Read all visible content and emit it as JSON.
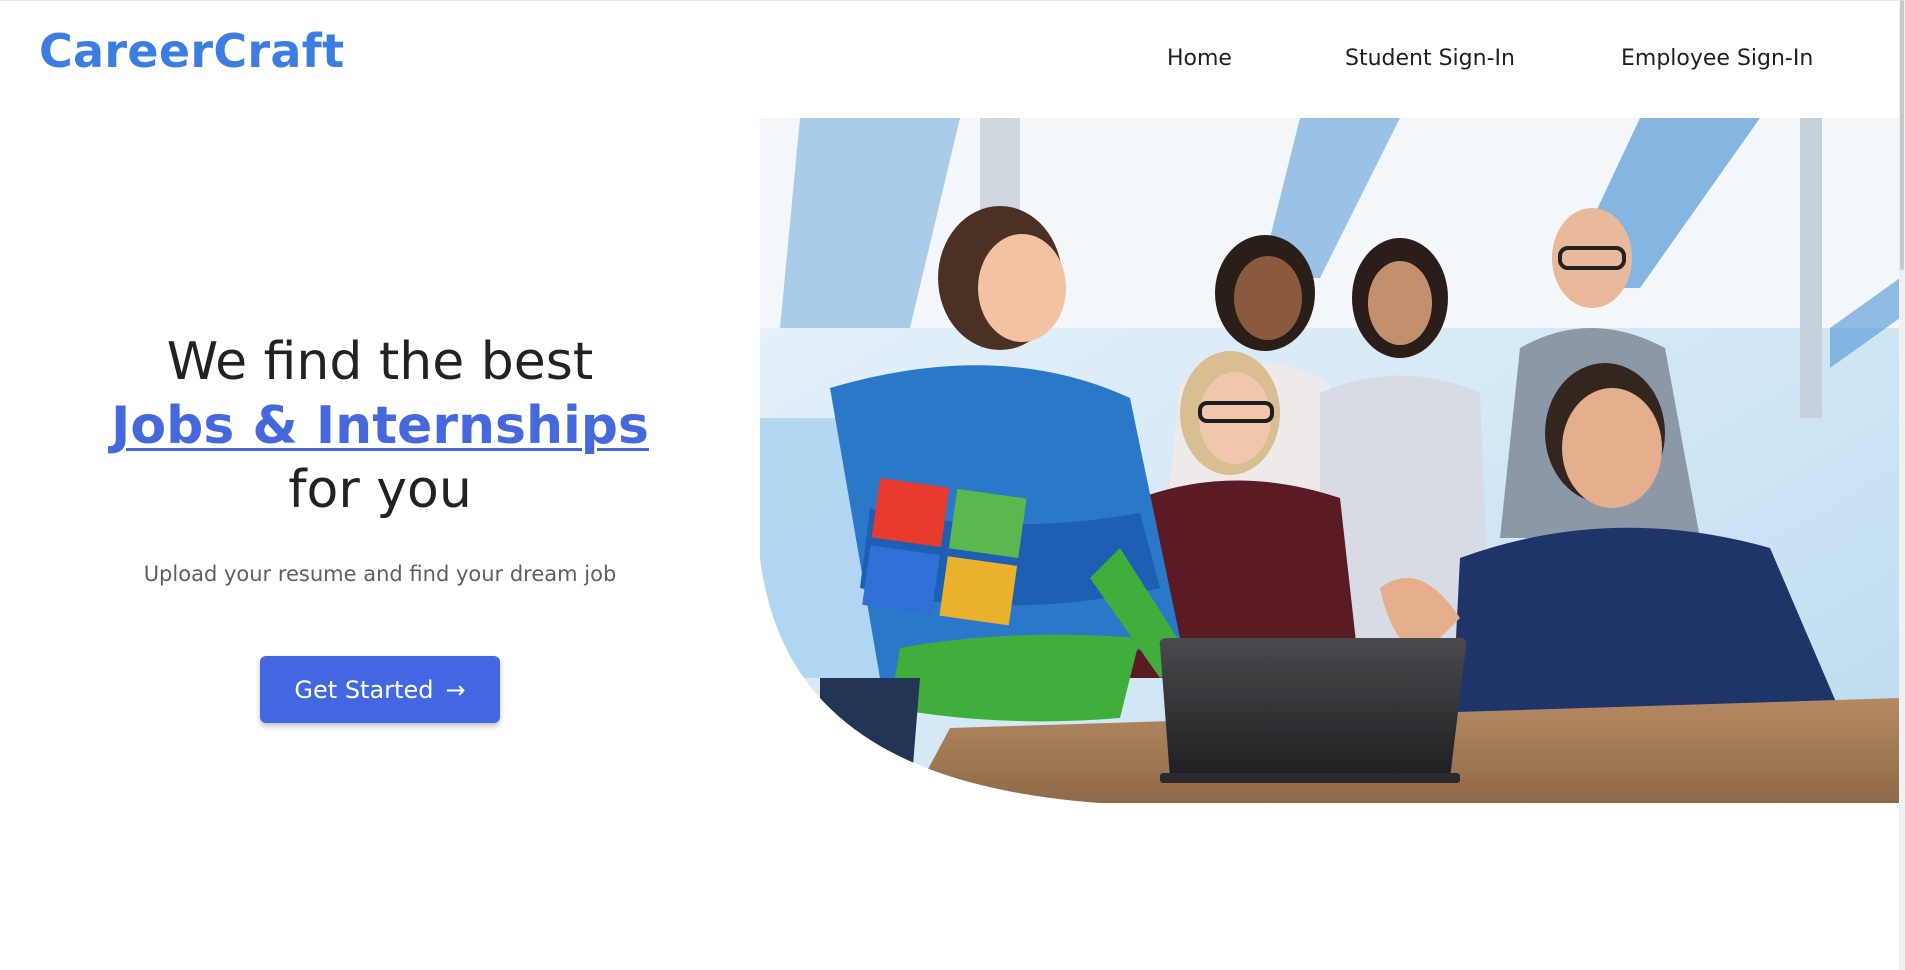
{
  "header": {
    "brand": "CareerCraft",
    "nav": [
      {
        "label": "Home"
      },
      {
        "label": "Student Sign-In"
      },
      {
        "label": "Employee Sign-In"
      }
    ]
  },
  "hero": {
    "headline_line1": "We find the best",
    "headline_highlight": "Jobs & Internships",
    "headline_line3": "for you",
    "subtitle": "Upload your resume and find your dream job",
    "cta_label": "Get Started",
    "cta_icon": "arrow-right-icon",
    "image_alt": "Group of people celebrating around a laptop in an office"
  },
  "colors": {
    "brand": "#3b7de0",
    "accent": "#4267e0",
    "highlight": "#4569dd"
  }
}
